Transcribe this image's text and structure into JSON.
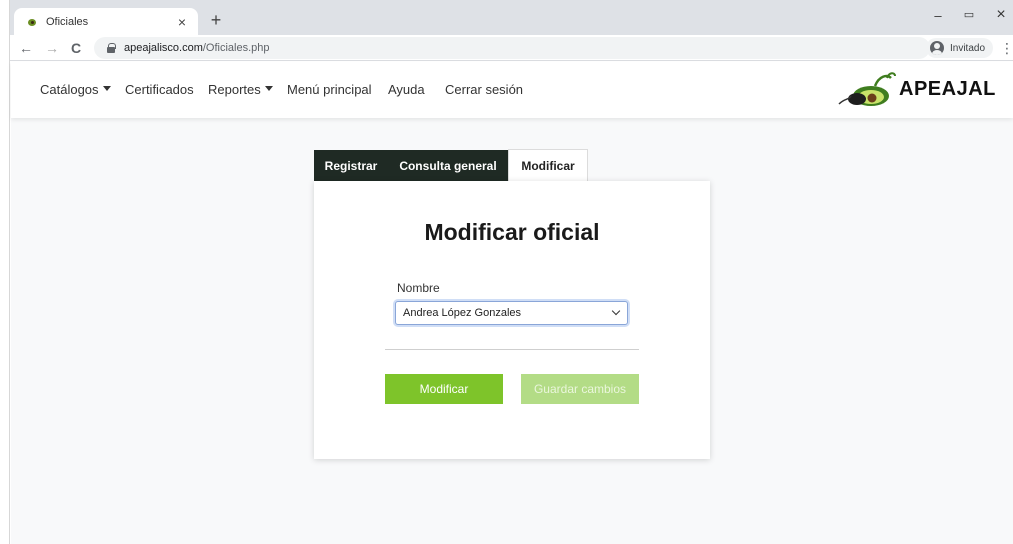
{
  "browser": {
    "tab_title": "Oficiales",
    "tab_close": "×",
    "new_tab": "+",
    "url_host": "apeajalisco.com",
    "url_path": "/Oficiales.php",
    "profile_label": "Invitado",
    "back": "←",
    "forward": "→",
    "reload": "C",
    "menu": "⋮",
    "minimize": "–",
    "restore": "▭",
    "close": "×"
  },
  "navbar": {
    "items": [
      {
        "label": "Catálogos",
        "dropdown": true
      },
      {
        "label": "Certificados",
        "dropdown": false
      },
      {
        "label": "Reportes",
        "dropdown": true
      },
      {
        "label": "Menú principal",
        "dropdown": false
      },
      {
        "label": "Ayuda",
        "dropdown": false
      },
      {
        "label": "Cerrar sesión",
        "dropdown": false
      }
    ],
    "logo_text": "APEAJAL"
  },
  "tabs": [
    {
      "label": "Registrar",
      "active": false
    },
    {
      "label": "Consulta general",
      "active": false
    },
    {
      "label": "Modificar",
      "active": true
    }
  ],
  "form": {
    "title": "Modificar oficial",
    "field_label": "Nombre",
    "selected_value": "Andrea López Gonzales",
    "primary_button": "Modificar",
    "secondary_button": "Guardar cambios",
    "secondary_disabled": true
  },
  "colors": {
    "accent": "#7ec42a",
    "accent_disabled": "#b3dc86",
    "dark_tab": "#1f2a24"
  }
}
